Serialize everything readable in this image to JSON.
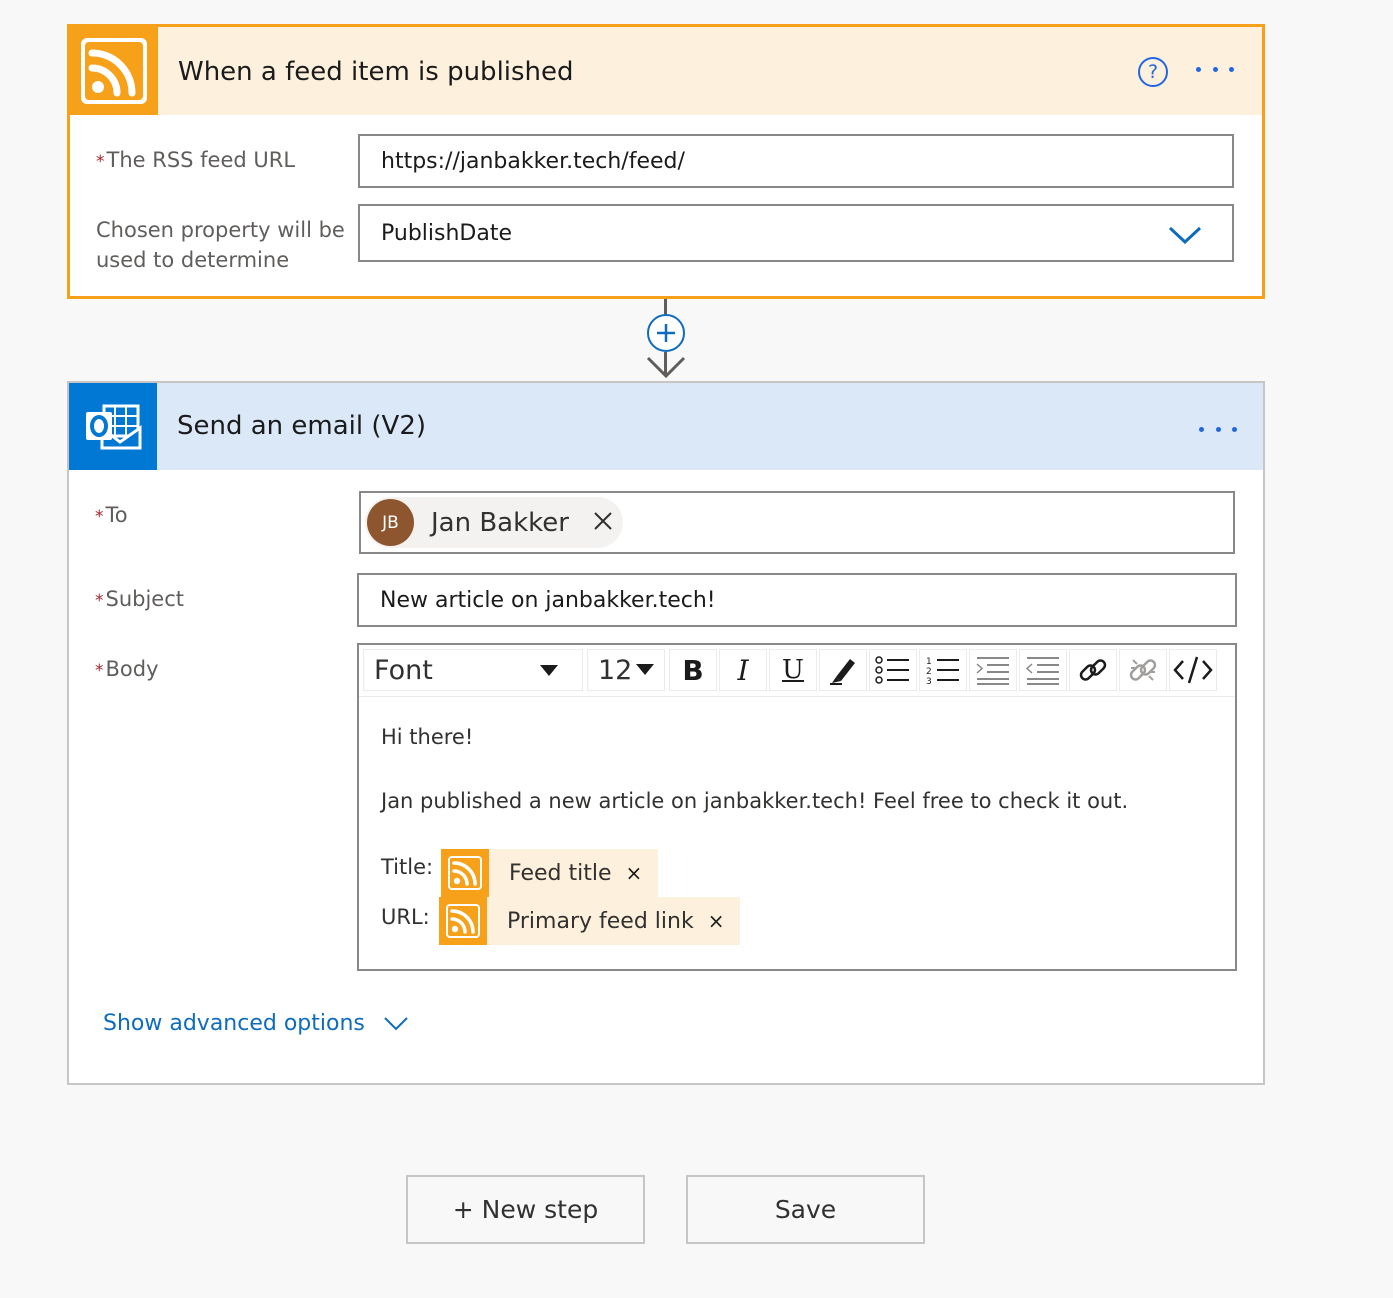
{
  "trigger": {
    "title": "When a feed item is published",
    "icon": "rss-icon",
    "help_icon": "question-icon",
    "more_icon": "ellipsis-icon",
    "fields": {
      "feed_url": {
        "label": "The RSS feed URL",
        "required": true,
        "value": "https://janbakker.tech/feed/"
      },
      "property": {
        "label_line1": "Chosen property will be",
        "label_line2": "used to determine",
        "required": false,
        "value": "PublishDate"
      }
    },
    "accent_color": "#f7a11a",
    "header_color": "#fdf1dd"
  },
  "connector": {
    "add_icon": "plus-icon",
    "arrow_icon": "arrow-down-icon"
  },
  "email": {
    "title": "Send an email (V2)",
    "icon": "outlook-icon",
    "more_icon": "ellipsis-icon",
    "accent_color": "#0078d4",
    "header_color": "#dae8f8",
    "to": {
      "label": "To",
      "required": true,
      "recipient": {
        "initials": "JB",
        "name": "Jan Bakker",
        "avatar_color": "#8e562e"
      }
    },
    "subject": {
      "label": "Subject",
      "required": true,
      "value": "New article on janbakker.tech!"
    },
    "body": {
      "label": "Body",
      "required": true,
      "toolbar": {
        "font": "Font",
        "size": "12",
        "buttons": [
          "bold",
          "italic",
          "underline",
          "highlight",
          "bullet-list",
          "numbered-list",
          "indent",
          "outdent",
          "link",
          "unlink",
          "code-view"
        ],
        "bold_glyph": "B",
        "italic_glyph": "I",
        "underline_glyph": "U"
      },
      "line1": "Hi there!",
      "line2": "Jan published a new article on janbakker.tech! Feel free to check it out.",
      "title_label": "Title:",
      "url_label": "URL:",
      "tokens": [
        {
          "label": "Feed title",
          "remove": "×"
        },
        {
          "label": "Primary feed link",
          "remove": "×"
        }
      ]
    },
    "advanced_options": "Show advanced options"
  },
  "footer": {
    "new_step": "+ New step",
    "save": "Save"
  }
}
